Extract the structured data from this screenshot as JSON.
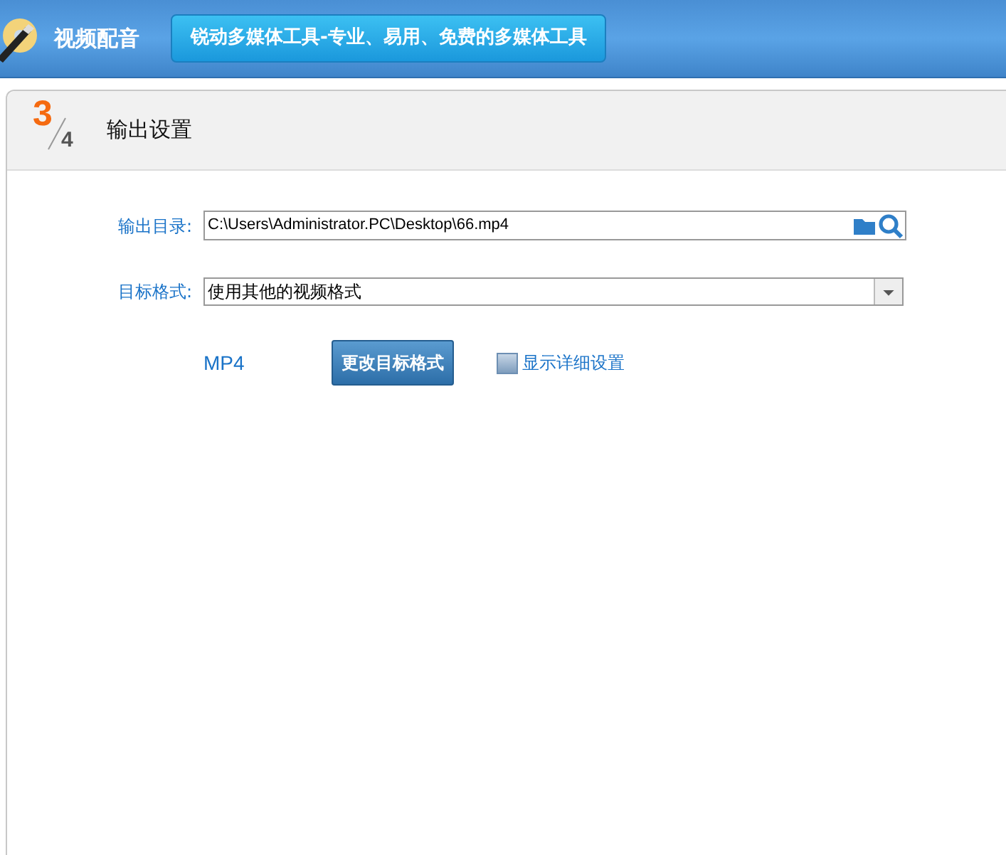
{
  "header": {
    "app_title": "视频配音",
    "slogan": "锐动多媒体工具-专业、易用、免费的多媒体工具"
  },
  "step": {
    "current": "3",
    "total": "4",
    "title": "输出设置"
  },
  "output_dir": {
    "label": "输出目录:",
    "value": "C:\\Users\\Administrator.PC\\Desktop\\66.mp4"
  },
  "target_format": {
    "label": "目标格式:",
    "value": "使用其他的视频格式"
  },
  "format_name": "MP4",
  "change_button": "更改目标格式",
  "details_checkbox": {
    "label": "显示详细设置",
    "checked": false
  }
}
